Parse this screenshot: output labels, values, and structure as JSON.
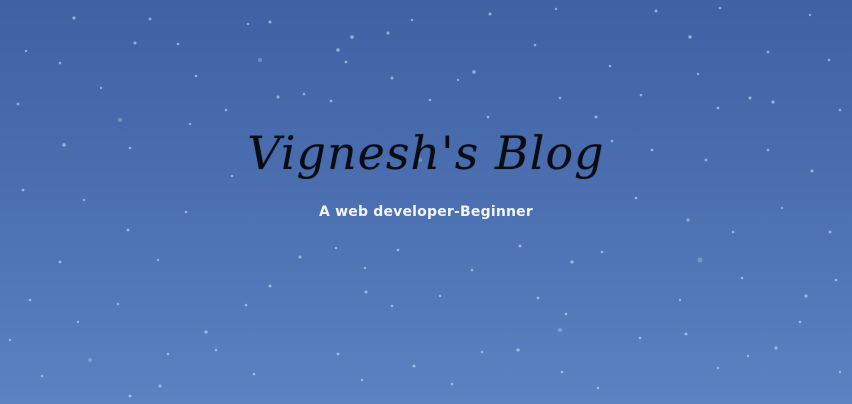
{
  "header": {
    "title": "Vignesh's Blog",
    "tagline": "A web developer-Beginner"
  },
  "colors": {
    "sky_top": "#3e62a4",
    "sky_bottom": "#5c82c2",
    "title_text": "#0b0b12",
    "tagline_text": "#f1f4fb"
  }
}
